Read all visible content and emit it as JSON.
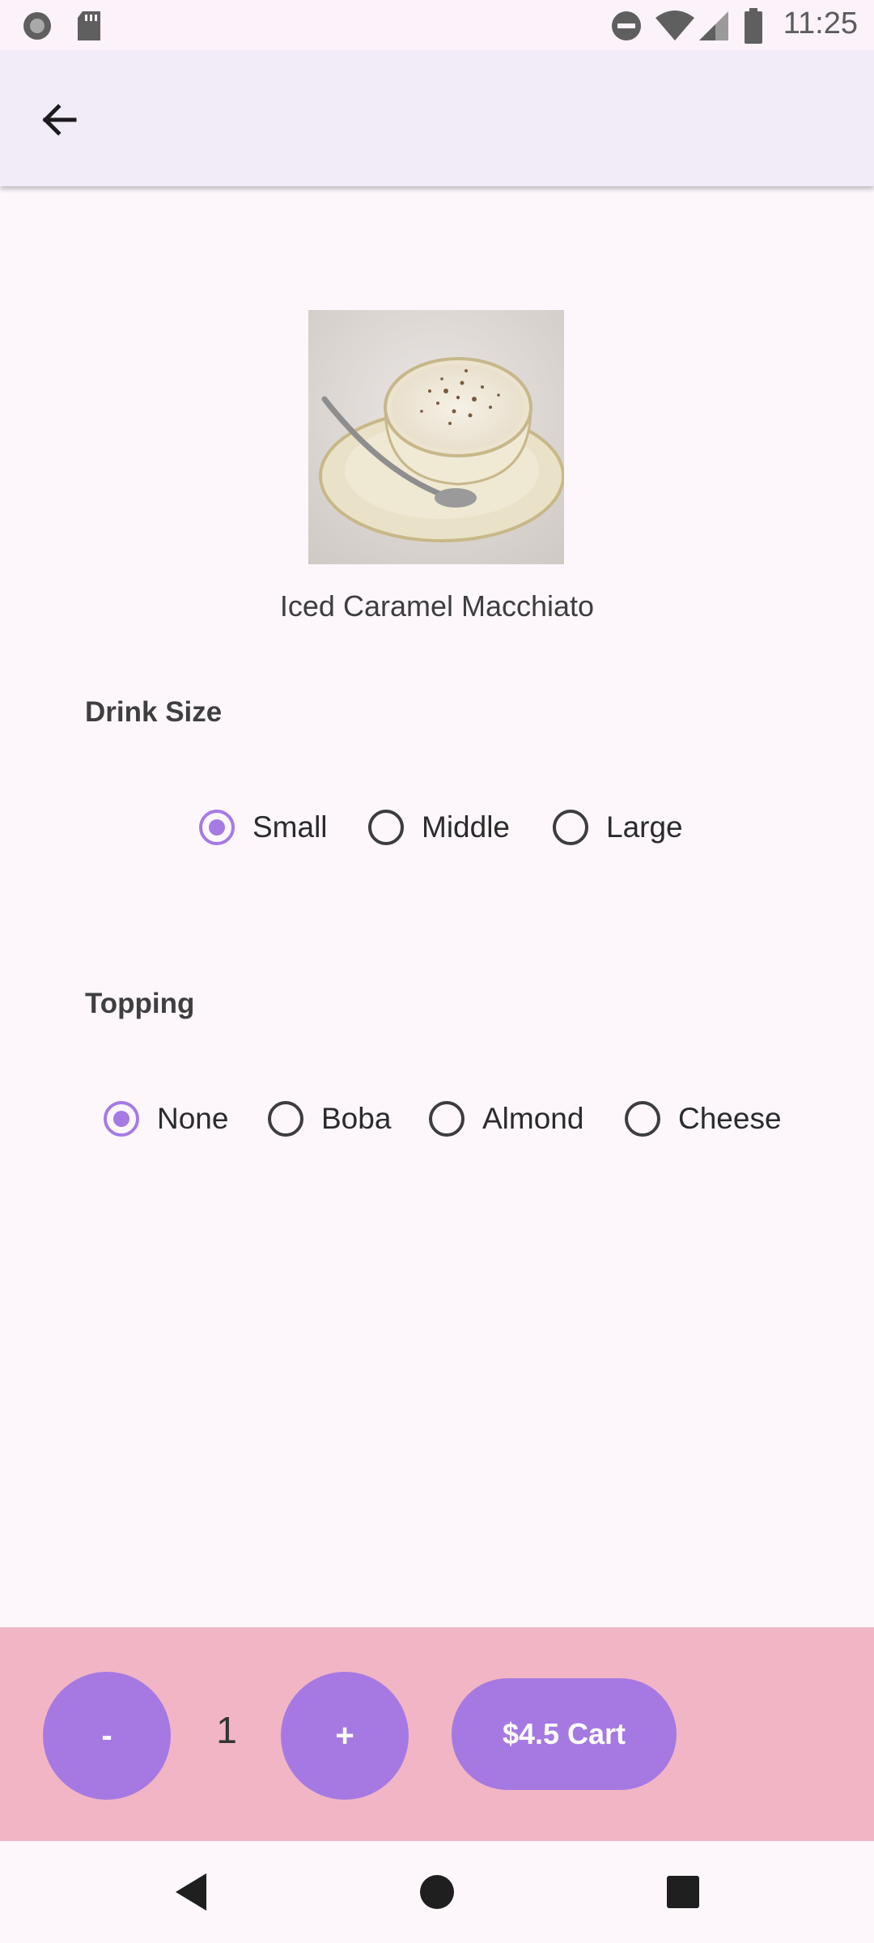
{
  "status_bar": {
    "time": "11:25",
    "icons": [
      "record-icon",
      "sd-card-icon",
      "dnd-icon",
      "wifi-icon",
      "signal-icon",
      "battery-icon"
    ]
  },
  "app_bar": {
    "back_icon": "arrow-back-icon"
  },
  "product": {
    "image": "cappuccino-cup-photo",
    "name": "Iced Caramel Macchiato"
  },
  "drink_size": {
    "title": "Drink Size",
    "options": [
      {
        "label": "Small",
        "selected": true
      },
      {
        "label": "Middle",
        "selected": false
      },
      {
        "label": "Large",
        "selected": false
      }
    ]
  },
  "topping": {
    "title": "Topping",
    "options": [
      {
        "label": "None",
        "selected": true
      },
      {
        "label": "Boba",
        "selected": false
      },
      {
        "label": "Almond",
        "selected": false
      },
      {
        "label": "Cheese",
        "selected": false
      }
    ]
  },
  "cart_bar": {
    "minus_label": "-",
    "quantity": "1",
    "plus_label": "+",
    "cart_label": "$4.5 Cart"
  },
  "nav_bar": {
    "icons": [
      "back-triangle-icon",
      "home-circle-icon",
      "recents-square-icon"
    ]
  },
  "colors": {
    "accent": "#a679e2",
    "cart_bar_bg": "#f2b5c5",
    "page_bg": "#fdf7fc",
    "app_bar_bg": "#f1ecf7"
  }
}
